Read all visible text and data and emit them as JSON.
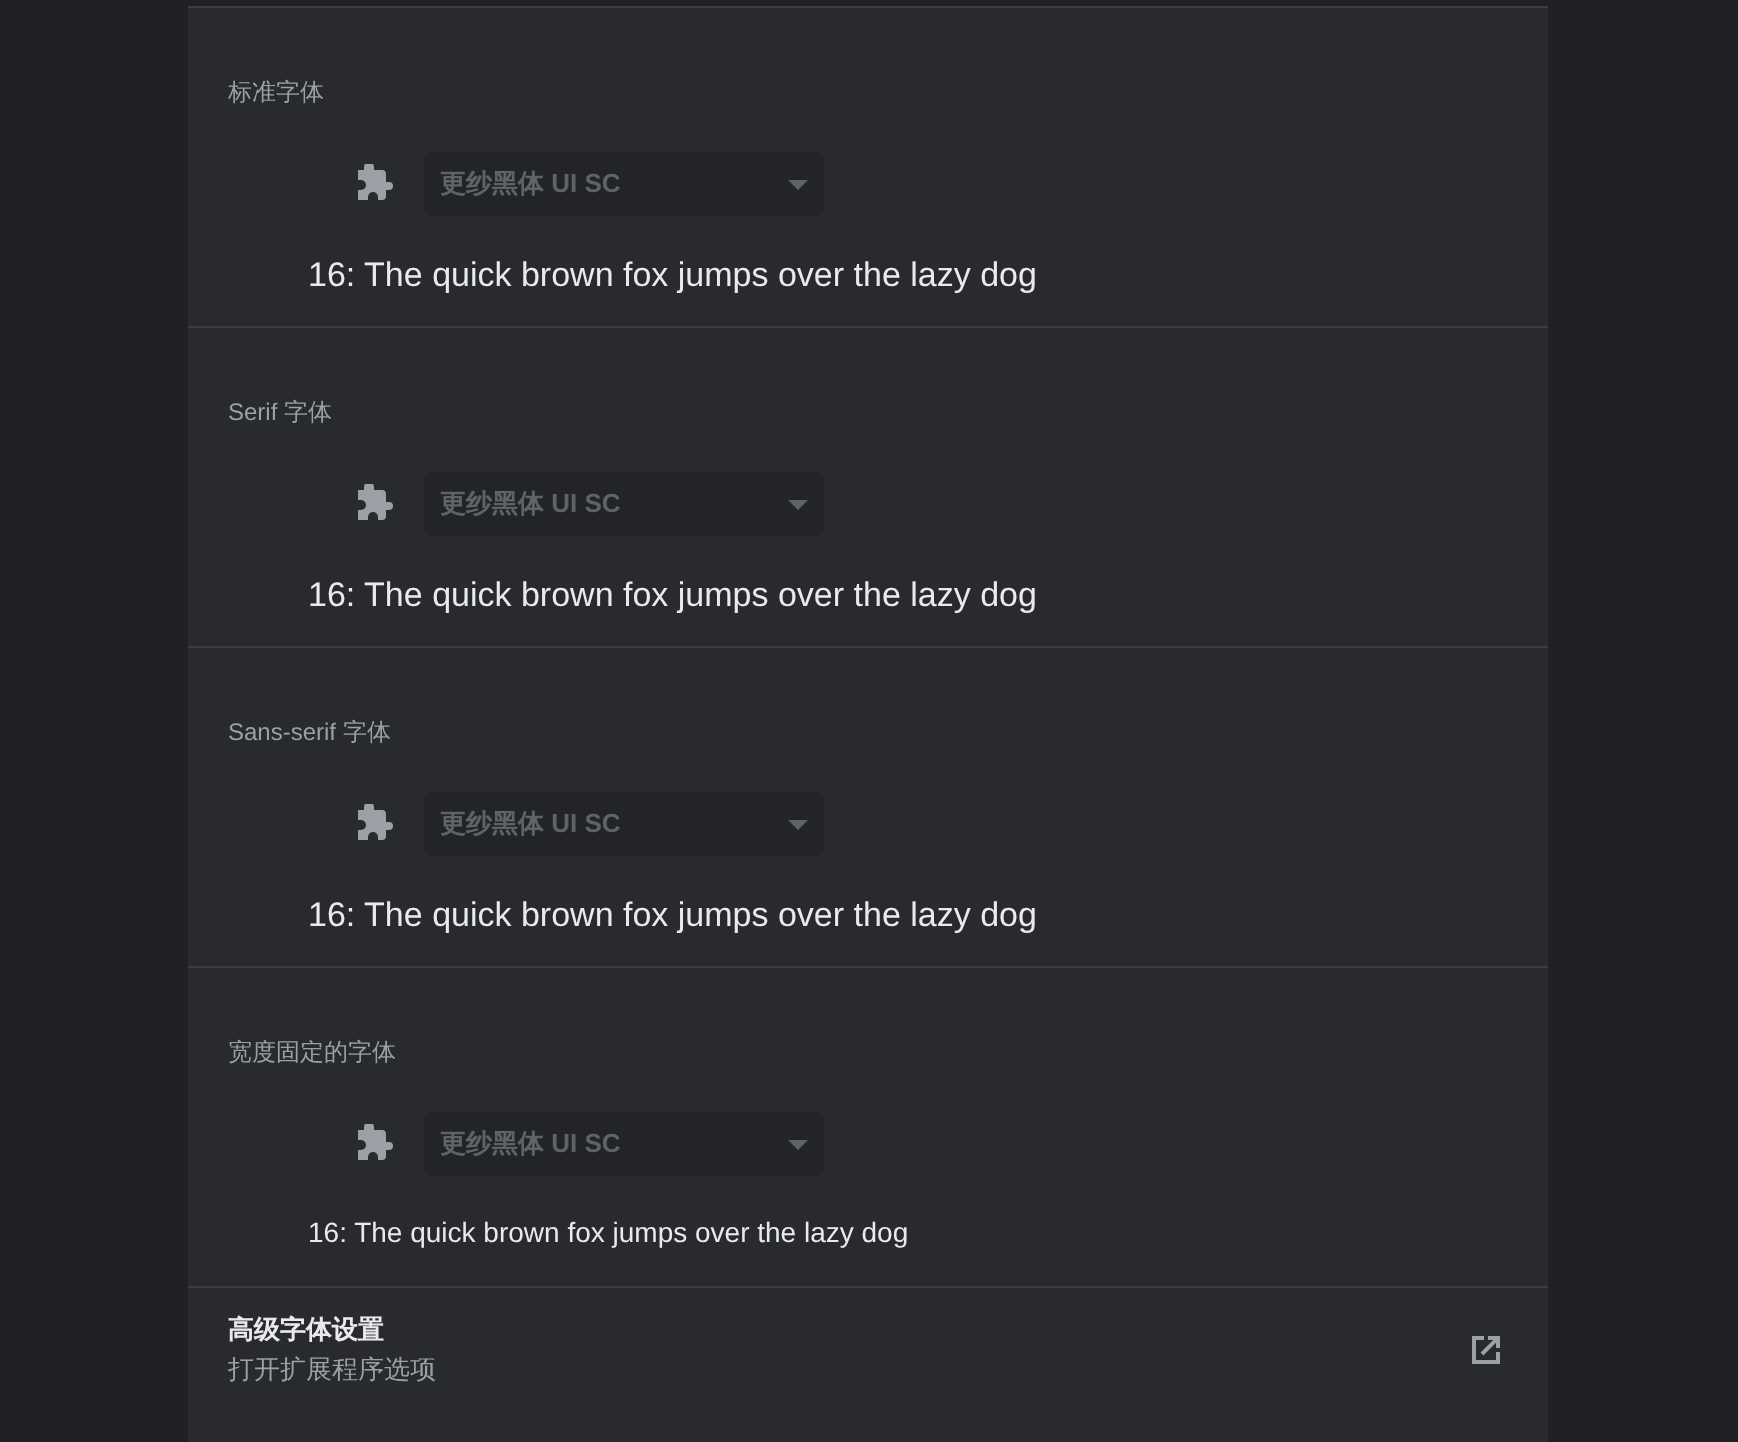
{
  "sections": [
    {
      "label": "标准字体",
      "kind": "standard",
      "dropdown": {
        "value": "更纱黑体 UI SC",
        "disabled": true
      },
      "sample": "16: The quick brown fox jumps over the lazy dog"
    },
    {
      "label": "Serif 字体",
      "kind": "serif",
      "dropdown": {
        "value": "更纱黑体 UI SC",
        "disabled": true
      },
      "sample": "16: The quick brown fox jumps over the lazy dog"
    },
    {
      "label": "Sans-serif 字体",
      "kind": "sans",
      "dropdown": {
        "value": "更纱黑体 UI SC",
        "disabled": true
      },
      "sample": "16: The quick brown fox jumps over the lazy dog"
    },
    {
      "label": "宽度固定的字体",
      "kind": "fixed",
      "dropdown": {
        "value": "更纱黑体 UI SC",
        "disabled": true
      },
      "sample": "16: The quick brown fox jumps over the lazy dog"
    }
  ],
  "advanced": {
    "title": "高级字体设置",
    "subtitle": "打开扩展程序选项"
  }
}
